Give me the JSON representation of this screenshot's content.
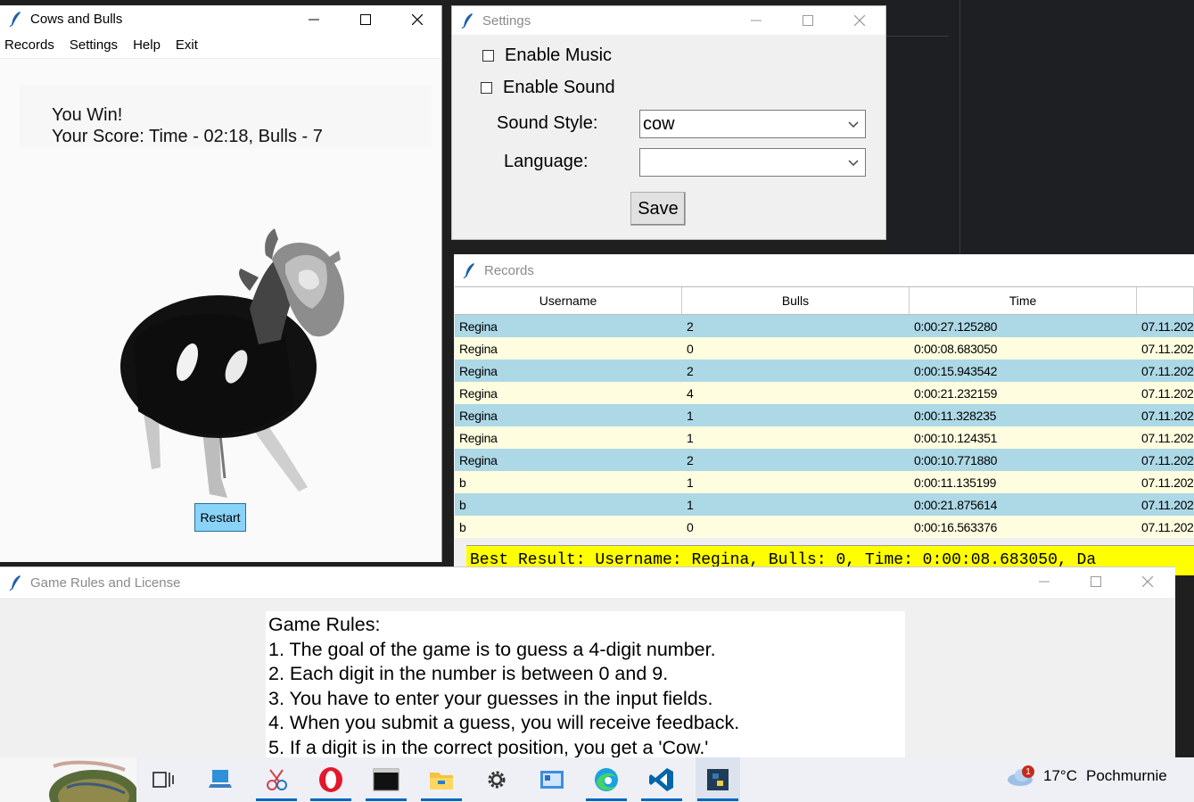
{
  "cows_window": {
    "title": "Cows and Bulls",
    "menu": [
      "Records",
      "Settings",
      "Help",
      "Exit"
    ],
    "win_line1": "You Win!",
    "win_line2": "Your Score:  Time - 02:18, Bulls - 7",
    "restart_label": "Restart"
  },
  "settings_window": {
    "title": "Settings",
    "enable_music_label": "Enable Music",
    "enable_sound_label": "Enable Sound",
    "enable_music_checked": false,
    "enable_sound_checked": false,
    "sound_style_label": "Sound Style:",
    "sound_style_value": "cow",
    "language_label": "Language:",
    "language_value": "",
    "save_label": "Save"
  },
  "records_window": {
    "title": "Records",
    "columns": [
      "Username",
      "Bulls",
      "Time",
      ""
    ],
    "rows": [
      [
        "Regina",
        "2",
        "0:00:27.125280",
        "07.11.202"
      ],
      [
        "Regina",
        "0",
        "0:00:08.683050",
        "07.11.202"
      ],
      [
        "Regina",
        "2",
        "0:00:15.943542",
        "07.11.202"
      ],
      [
        "Regina",
        "4",
        "0:00:21.232159",
        "07.11.202"
      ],
      [
        "Regina",
        "1",
        "0:00:11.328235",
        "07.11.202"
      ],
      [
        "Regina",
        "1",
        "0:00:10.124351",
        "07.11.202"
      ],
      [
        "Regina",
        "2",
        "0:00:10.771880",
        "07.11.202"
      ],
      [
        "b",
        "1",
        "0:00:11.135199",
        "07.11.202"
      ],
      [
        "b",
        "1",
        "0:00:21.875614",
        "07.11.202"
      ],
      [
        "b",
        "0",
        "0:00:16.563376",
        "07.11.202"
      ]
    ],
    "row_colors": [
      "#add8e6",
      "#fffde0"
    ],
    "best_result": "Best Result: Username: Regina, Bulls: 0, Time: 0:00:08.683050, Da"
  },
  "rules_window": {
    "title": "Game Rules and License",
    "lines": [
      "Game Rules:",
      "1. The goal of the game is to guess a 4-digit number.",
      "2. Each digit in the number is between 0 and 9.",
      "3. You have to enter your guesses in the input fields.",
      "4. When you submit a guess, you will receive feedback.",
      "5. If a digit is in the correct position, you get a 'Cow.'"
    ]
  },
  "taskbar": {
    "icons": [
      "task-view-icon",
      "this-pc-icon",
      "snipping-tool-icon",
      "opera-icon",
      "terminal-icon",
      "file-explorer-icon",
      "settings-gear-icon",
      "control-panel-icon",
      "edge-icon",
      "vscode-icon",
      "python-icon"
    ],
    "weather_temp": "17°C",
    "weather_desc": "Pochmurnie",
    "notification_count": "1"
  },
  "accent_color": "#0067c0",
  "best_result_bg": "#ffff00",
  "restart_bg": "#8ad3f8"
}
